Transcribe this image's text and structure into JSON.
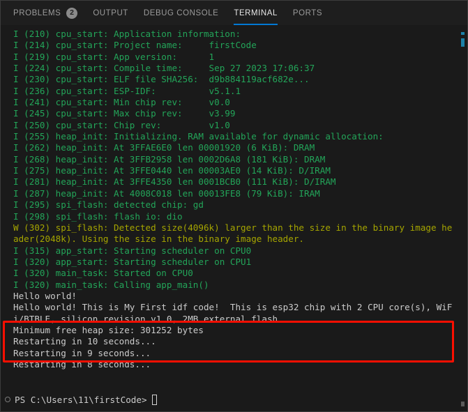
{
  "tabs": [
    {
      "label": "PROBLEMS",
      "badge": "2",
      "active": false,
      "name": "tab-problems"
    },
    {
      "label": "OUTPUT",
      "badge": null,
      "active": false,
      "name": "tab-output"
    },
    {
      "label": "DEBUG CONSOLE",
      "badge": null,
      "active": false,
      "name": "tab-debug-console"
    },
    {
      "label": "TERMINAL",
      "badge": null,
      "active": true,
      "name": "tab-terminal"
    },
    {
      "label": "PORTS",
      "badge": null,
      "active": false,
      "name": "tab-ports"
    }
  ],
  "terminal": {
    "lines": [
      {
        "text": "I (210) cpu_start: Application information:",
        "level": "info"
      },
      {
        "text": "I (214) cpu_start: Project name:     firstCode",
        "level": "info"
      },
      {
        "text": "I (219) cpu_start: App version:      1",
        "level": "info"
      },
      {
        "text": "I (224) cpu_start: Compile time:     Sep 27 2023 17:06:37",
        "level": "info"
      },
      {
        "text": "I (230) cpu_start: ELF file SHA256:  d9b884119acf682e...",
        "level": "info"
      },
      {
        "text": "I (236) cpu_start: ESP-IDF:          v5.1.1",
        "level": "info"
      },
      {
        "text": "I (241) cpu_start: Min chip rev:     v0.0",
        "level": "info"
      },
      {
        "text": "I (245) cpu_start: Max chip rev:     v3.99",
        "level": "info"
      },
      {
        "text": "I (250) cpu_start: Chip rev:         v1.0",
        "level": "info"
      },
      {
        "text": "I (255) heap_init: Initializing. RAM available for dynamic allocation:",
        "level": "info"
      },
      {
        "text": "I (262) heap_init: At 3FFAE6E0 len 00001920 (6 KiB): DRAM",
        "level": "info"
      },
      {
        "text": "I (268) heap_init: At 3FFB2958 len 0002D6A8 (181 KiB): DRAM",
        "level": "info"
      },
      {
        "text": "I (275) heap_init: At 3FFE0440 len 00003AE0 (14 KiB): D/IRAM",
        "level": "info"
      },
      {
        "text": "I (281) heap_init: At 3FFE4350 len 0001BCB0 (111 KiB): D/IRAM",
        "level": "info"
      },
      {
        "text": "I (287) heap_init: At 4008C018 len 00013FE8 (79 KiB): IRAM",
        "level": "info"
      },
      {
        "text": "I (295) spi_flash: detected chip: gd",
        "level": "info"
      },
      {
        "text": "I (298) spi_flash: flash io: dio",
        "level": "info"
      },
      {
        "text": "W (302) spi_flash: Detected size(4096k) larger than the size in the binary image header(2048k). Using the size in the binary image header.",
        "level": "warn"
      },
      {
        "text": "I (315) app_start: Starting scheduler on CPU0",
        "level": "info"
      },
      {
        "text": "I (320) app_start: Starting scheduler on CPU1",
        "level": "info"
      },
      {
        "text": "I (320) main_task: Started on CPU0",
        "level": "info"
      },
      {
        "text": "I (320) main_task: Calling app_main()",
        "level": "info"
      },
      {
        "text": "Hello world!",
        "level": "plain"
      },
      {
        "text": "Hello world! This is My First idf code!  This is esp32 chip with 2 CPU core(s), WiFi/BTBLE, silicon revision v1.0, 2MB external flash",
        "level": "plain"
      },
      {
        "text": "Minimum free heap size: 301252 bytes",
        "level": "plain"
      },
      {
        "text": "Restarting in 10 seconds...",
        "level": "plain"
      },
      {
        "text": "Restarting in 9 seconds...",
        "level": "plain"
      },
      {
        "text": "Restarting in 8 seconds...",
        "level": "plain"
      }
    ],
    "prompt": {
      "text": "PS C:\\Users\\11\\firstCode>",
      "cursor": ""
    }
  },
  "annotation": {
    "type": "red-rectangle-highlight",
    "color": "#fa0f00"
  },
  "colors": {
    "background": "#1e1e1e",
    "terminal_background": "#1a1a1a",
    "info": "#23a559",
    "warn": "#a5a500",
    "plain": "#cccccc",
    "accent": "#0078d4",
    "annotation": "#fa0f00"
  }
}
